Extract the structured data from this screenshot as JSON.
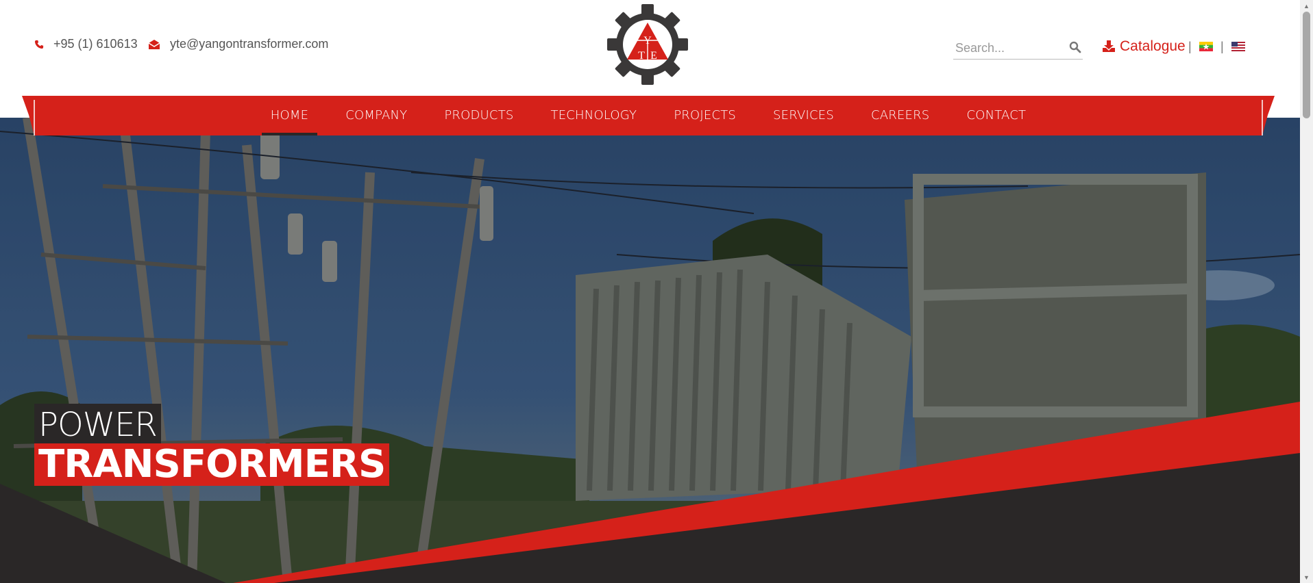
{
  "header": {
    "phone": "+95 (1) 610613",
    "email": "yte@yangontransformer.com",
    "logo_letters": {
      "top": "Y",
      "left": "T",
      "right": "E"
    },
    "search_placeholder": "Search...",
    "catalogue_label": "Catalogue",
    "separator": "|",
    "languages": [
      "myanmar-flag",
      "us-flag"
    ]
  },
  "nav": {
    "items": [
      "HOME",
      "COMPANY",
      "PRODUCTS",
      "TECHNOLOGY",
      "PROJECTS",
      "SERVICES",
      "CAREERS",
      "CONTACT"
    ],
    "active": "HOME"
  },
  "hero": {
    "line1": "POWER",
    "line2": "TRANSFORMERS"
  },
  "colors": {
    "brand_red": "#d5211a",
    "dark": "#2a2727"
  }
}
